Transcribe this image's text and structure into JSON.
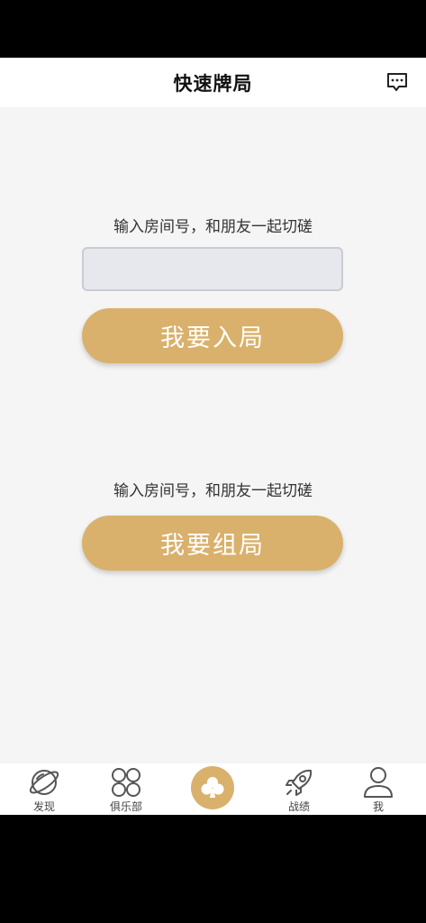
{
  "header": {
    "title": "快速牌局"
  },
  "join": {
    "hint": "输入房间号，和朋友一起切磋",
    "input_value": "",
    "button_label": "我要入局"
  },
  "create": {
    "hint": "输入房间号，和朋友一起切磋",
    "button_label": "我要组局"
  },
  "tabs": [
    {
      "label": "发现",
      "icon": "planet-icon"
    },
    {
      "label": "俱乐部",
      "icon": "four-circles-icon"
    },
    {
      "label": "",
      "icon": "club-icon"
    },
    {
      "label": "战绩",
      "icon": "rocket-icon"
    },
    {
      "label": "我",
      "icon": "person-icon"
    }
  ],
  "colors": {
    "accent": "#d9b16c",
    "background": "#f5f5f5"
  }
}
